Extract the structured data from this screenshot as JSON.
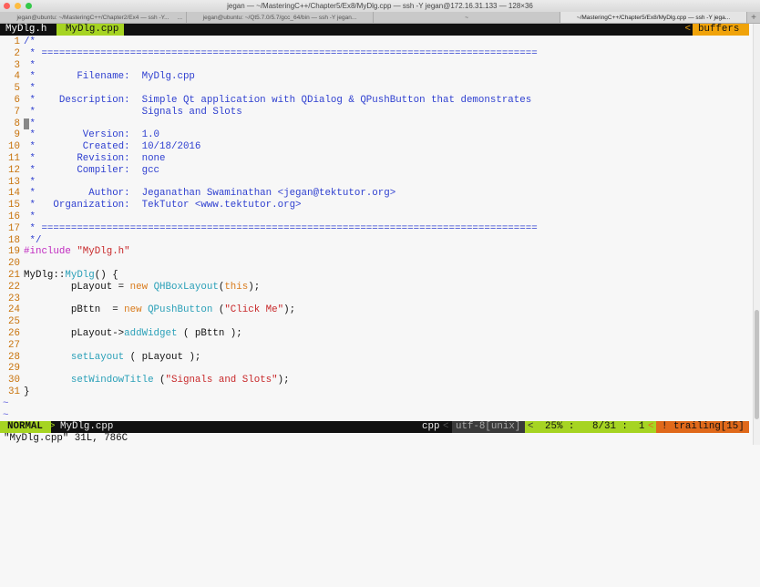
{
  "window": {
    "title": "jegan — ~/MasteringC++/Chapter5/Ex8/MyDlg.cpp — ssh -Y jegan@172.16.31.133 — 128×36"
  },
  "tabs": [
    {
      "label": "jegan@ubuntu: ~/MasteringC++/Chapter2/Ex4 — ssh -Y...",
      "extra": "..."
    },
    {
      "label": "jegan@ubuntu: ~/Qt5.7.0/5.7/gcc_64/bin — ssh -Y jegan...",
      "extra": ""
    },
    {
      "label": "~",
      "extra": ""
    },
    {
      "label": "~/MasteringC++/Chapter5/Ex8/MyDlg.cpp — ssh -Y jega...",
      "extra": ""
    }
  ],
  "buffers": {
    "items": [
      "MyDlg.h",
      "MyDlg.cpp"
    ],
    "active": 1,
    "label": "buffers",
    "arrow": "<"
  },
  "colors": {
    "accent_green": "#a6d422",
    "orange": "#f0a30a",
    "trailing": "#e0691a"
  },
  "lines": [
    [
      [
        "cm",
        "/*"
      ]
    ],
    [
      [
        "cm",
        " * ===================================================================================="
      ]
    ],
    [
      [
        "cm",
        " *"
      ]
    ],
    [
      [
        "cm",
        " *       Filename:  MyDlg.cpp"
      ]
    ],
    [
      [
        "cm",
        " *"
      ]
    ],
    [
      [
        "cm",
        " *    Description:  Simple Qt application with QDialog & QPushButton that demonstrates"
      ]
    ],
    [
      [
        "cm",
        " *                  Signals and Slots"
      ]
    ],
    [
      [
        "cursor",
        " "
      ],
      [
        "cm",
        "*"
      ]
    ],
    [
      [
        "cm",
        " *        Version:  1.0"
      ]
    ],
    [
      [
        "cm",
        " *        Created:  10/18/2016"
      ]
    ],
    [
      [
        "cm",
        " *       Revision:  none"
      ]
    ],
    [
      [
        "cm",
        " *       Compiler:  gcc"
      ]
    ],
    [
      [
        "cm",
        " *"
      ]
    ],
    [
      [
        "cm",
        " *         Author:  Jeganathan Swaminathan <jegan@tektutor.org>"
      ]
    ],
    [
      [
        "cm",
        " *   Organization:  TekTutor <www.tektutor.org>"
      ]
    ],
    [
      [
        "cm",
        " *"
      ]
    ],
    [
      [
        "cm",
        " * ===================================================================================="
      ]
    ],
    [
      [
        "cm",
        " */"
      ]
    ],
    [
      [
        "pp",
        "#include "
      ],
      [
        "st",
        "\"MyDlg.h\""
      ]
    ],
    [],
    [
      [
        "tx",
        "MyDlg::"
      ],
      [
        "ty",
        "MyDlg"
      ],
      [
        "tx",
        "() {"
      ]
    ],
    [
      [
        "tx",
        "        pLayout = "
      ],
      [
        "kw",
        "new "
      ],
      [
        "ty",
        "QHBoxLayout"
      ],
      [
        "tx",
        "("
      ],
      [
        "kw",
        "this"
      ],
      [
        "tx",
        ");"
      ]
    ],
    [],
    [
      [
        "tx",
        "        pBttn  = "
      ],
      [
        "kw",
        "new "
      ],
      [
        "ty",
        "QPushButton"
      ],
      [
        "tx",
        " ("
      ],
      [
        "st",
        "\"Click Me\""
      ],
      [
        "tx",
        ");"
      ]
    ],
    [],
    [
      [
        "tx",
        "        pLayout->"
      ],
      [
        "ty",
        "addWidget"
      ],
      [
        "tx",
        " ( pBttn );"
      ]
    ],
    [],
    [
      [
        "tx",
        "        "
      ],
      [
        "ty",
        "setLayout"
      ],
      [
        "tx",
        " ( pLayout );"
      ]
    ],
    [],
    [
      [
        "tx",
        "        "
      ],
      [
        "ty",
        "setWindowTitle"
      ],
      [
        "tx",
        " ("
      ],
      [
        "st",
        "\"Signals and Slots\""
      ],
      [
        "tx",
        ");"
      ]
    ],
    [
      [
        "tx",
        "}"
      ]
    ]
  ],
  "tildes": [
    "~",
    "~"
  ],
  "status": {
    "mode": "NORMAL",
    "sep": ">",
    "file": "MyDlg.cpp",
    "filetype": "cpp",
    "encoding": "utf-8[unix]",
    "percent": "25% :",
    "position": "8/31 :",
    "column": "1",
    "warning": "! trailing[15]",
    "lt": "<"
  },
  "command_line": "\"MyDlg.cpp\" 31L, 786C"
}
